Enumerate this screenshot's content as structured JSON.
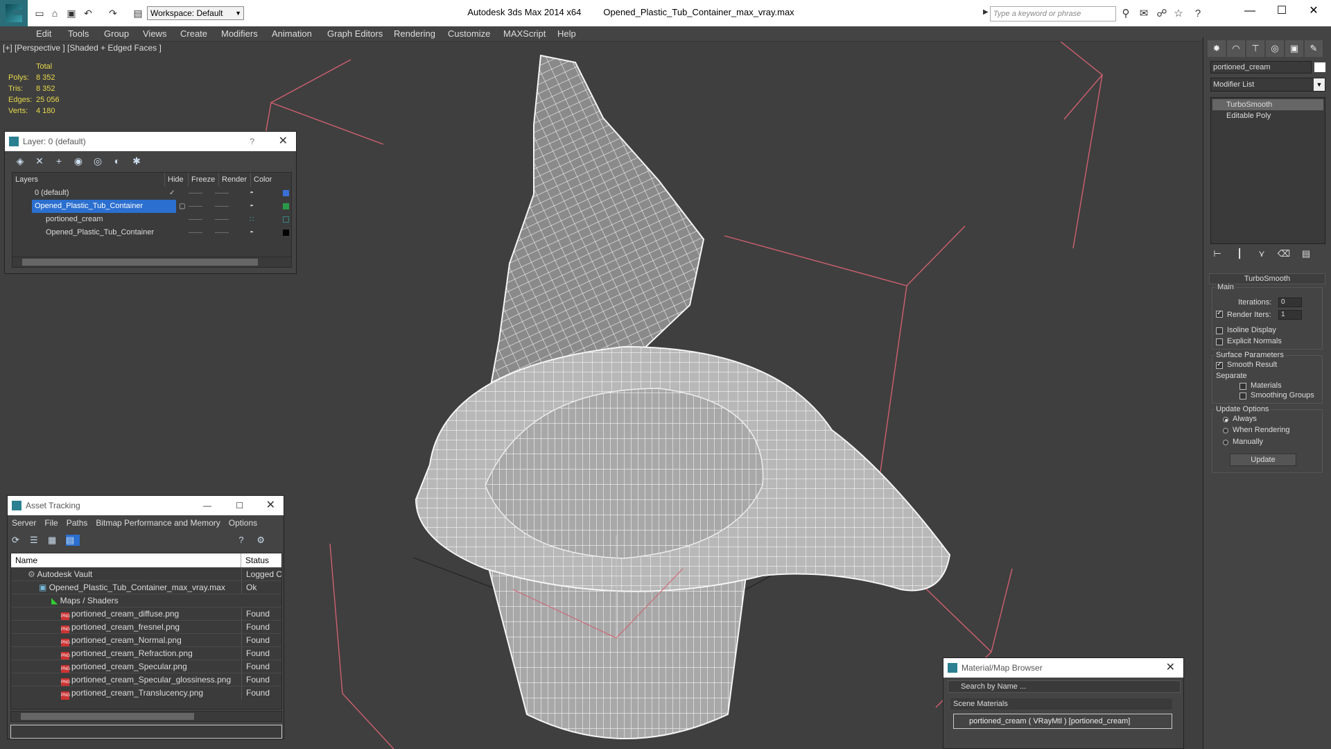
{
  "titlebar": {
    "workspace": "Workspace: Default",
    "app_title": "Autodesk 3ds Max  2014 x64",
    "file_title": "Opened_Plastic_Tub_Container_max_vray.max",
    "search_placeholder": "Type a keyword or phrase"
  },
  "menu": [
    "Edit",
    "Tools",
    "Group",
    "Views",
    "Create",
    "Modifiers",
    "Animation",
    "Graph Editors",
    "Rendering",
    "Customize",
    "MAXScript",
    "Help"
  ],
  "viewport": {
    "label": "[+] [Perspective ] [Shaded + Edged Faces ]",
    "stats": {
      "total_label": "Total",
      "polys_label": "Polys:",
      "polys": "8 352",
      "tris_label": "Tris:",
      "tris": "8 352",
      "edges_label": "Edges:",
      "edges": "25 056",
      "verts_label": "Verts:",
      "verts": "4 180"
    }
  },
  "layer_panel": {
    "title": "Layer: 0 (default)",
    "headers": {
      "layers": "Layers",
      "hide": "Hide",
      "freeze": "Freeze",
      "render": "Render",
      "color": "Color"
    },
    "rows": [
      {
        "name": "0 (default)",
        "color": "#3a6fd8"
      },
      {
        "name": "Opened_Plastic_Tub_Container",
        "color": "#2a9a4a"
      },
      {
        "name": "portioned_cream",
        "color": "#3ac8c8"
      },
      {
        "name": "Opened_Plastic_Tub_Container",
        "color": "#000000"
      }
    ]
  },
  "asset_panel": {
    "title": "Asset Tracking",
    "menu": [
      "Server",
      "File",
      "Paths",
      "Bitmap Performance and Memory",
      "Options"
    ],
    "headers": {
      "name": "Name",
      "status": "Status"
    },
    "rows": [
      {
        "name": "Autodesk Vault",
        "status": "Logged Out"
      },
      {
        "name": "Opened_Plastic_Tub_Container_max_vray.max",
        "status": "Ok"
      },
      {
        "name": "Maps / Shaders",
        "status": ""
      },
      {
        "name": "portioned_cream_diffuse.png",
        "status": "Found"
      },
      {
        "name": "portioned_cream_fresnel.png",
        "status": "Found"
      },
      {
        "name": "portioned_cream_Normal.png",
        "status": "Found"
      },
      {
        "name": "portioned_cream_Refraction.png",
        "status": "Found"
      },
      {
        "name": "portioned_cream_Specular.png",
        "status": "Found"
      },
      {
        "name": "portioned_cream_Specular_glossiness.png",
        "status": "Found"
      },
      {
        "name": "portioned_cream_Translucency.png",
        "status": "Found"
      }
    ]
  },
  "material_browser": {
    "title": "Material/Map Browser",
    "search_placeholder": "Search by Name ...",
    "group": "Scene Materials",
    "item": "portioned_cream  ( VRayMtl )  [portioned_cream]"
  },
  "command_panel": {
    "object_name": "portioned_cream",
    "modifier_list": "Modifier List",
    "stack": [
      "TurboSmooth",
      "Editable Poly"
    ],
    "rollout_title": "TurboSmooth",
    "main_label": "Main",
    "iterations_label": "Iterations:",
    "iterations": "0",
    "render_iters_label": "Render Iters:",
    "render_iters": "1",
    "isoline_label": "Isoline Display",
    "explicit_normals_label": "Explicit Normals",
    "surface_params_label": "Surface Parameters",
    "smooth_result_label": "Smooth Result",
    "separate_label": "Separate",
    "materials_label": "Materials",
    "smoothing_groups_label": "Smoothing Groups",
    "update_options_label": "Update Options",
    "always_label": "Always",
    "when_rendering_label": "When Rendering",
    "manually_label": "Manually",
    "update_button": "Update"
  },
  "colors": {
    "selection": "#2b6fd0",
    "stats": "#e8d94a",
    "viewport_bg": "#3f3f3f",
    "bbox": "#d06070"
  }
}
